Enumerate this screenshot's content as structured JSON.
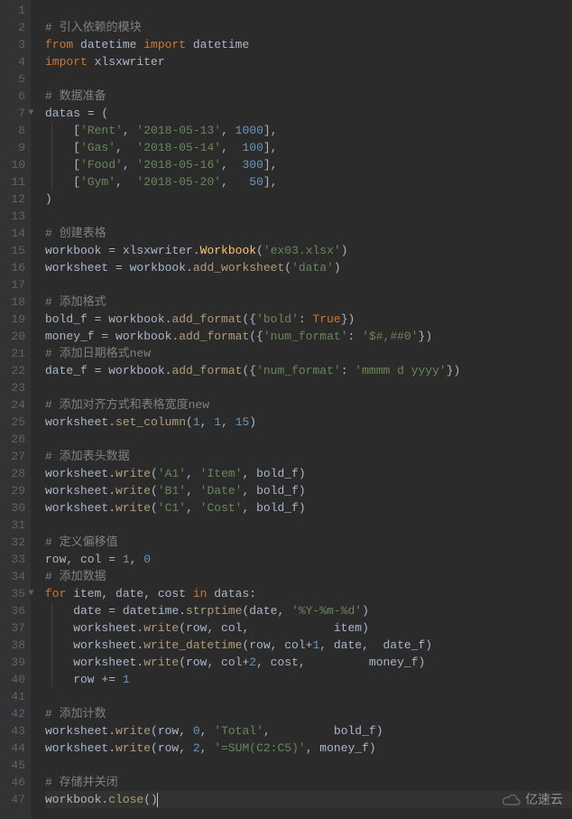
{
  "editor": {
    "line_count": 47,
    "current_line": 47,
    "fold_markers": [
      7,
      35
    ]
  },
  "code": {
    "l1": "",
    "l2": {
      "cm": "# 引入依赖的模块"
    },
    "l3": {
      "kw1": "from",
      "mod": " datetime ",
      "kw2": "import",
      "name": " datetime"
    },
    "l4": {
      "kw": "import",
      "name": " xlsxwriter"
    },
    "l5": "",
    "l6": {
      "cm": "# 数据准备"
    },
    "l7": {
      "lhs": "datas ",
      "op": "=",
      "rhs": " ("
    },
    "l8": {
      "open": "    [",
      "s1": "'Rent'",
      "c1": ", ",
      "s2": "'2018-05-13'",
      "c2": ", ",
      "n": "1000",
      "close": "],"
    },
    "l9": {
      "open": "    [",
      "s1": "'Gas'",
      "c1": ",  ",
      "s2": "'2018-05-14'",
      "c2": ",  ",
      "n": "100",
      "close": "],"
    },
    "l10": {
      "open": "    [",
      "s1": "'Food'",
      "c1": ", ",
      "s2": "'2018-05-16'",
      "c2": ",  ",
      "n": "300",
      "close": "],"
    },
    "l11": {
      "open": "    [",
      "s1": "'Gym'",
      "c1": ",  ",
      "s2": "'2018-05-20'",
      "c2": ",   ",
      "n": "50",
      "close": "],"
    },
    "l12": {
      "txt": ")"
    },
    "l13": "",
    "l14": {
      "cm": "# 创建表格"
    },
    "l15": {
      "a": "workbook ",
      "op": "=",
      "b": " xlsxwriter.",
      "fn": "Workbook",
      "c": "(",
      "s": "'ex03.xlsx'",
      "d": ")"
    },
    "l16": {
      "a": "worksheet ",
      "op": "=",
      "b": " workbook.",
      "fn": "add_worksheet",
      "c": "(",
      "s": "'data'",
      "d": ")"
    },
    "l17": "",
    "l18": {
      "cm": "# 添加格式"
    },
    "l19": {
      "a": "bold_f ",
      "op": "=",
      "b": " workbook.",
      "fn": "add_format",
      "c": "({",
      "s": "'bold'",
      "d": ": ",
      "kw": "True",
      "e": "})"
    },
    "l20": {
      "a": "money_f ",
      "op": "=",
      "b": " workbook.",
      "fn": "add_format",
      "c": "({",
      "s1": "'num_format'",
      "d": ": ",
      "s2": "'$#,##0'",
      "e": "})"
    },
    "l21": {
      "cm": "# 添加日期格式new"
    },
    "l22": {
      "a": "date_f ",
      "op": "=",
      "b": " workbook.",
      "fn": "add_format",
      "c": "({",
      "s1": "'num_format'",
      "d": ": ",
      "s2": "'mmmm d yyyy'",
      "e": "})"
    },
    "l23": "",
    "l24": {
      "cm": "# 添加对齐方式和表格宽度new"
    },
    "l25": {
      "a": "worksheet.",
      "fn": "set_column",
      "b": "(",
      "n1": "1",
      "c1": ", ",
      "n2": "1",
      "c2": ", ",
      "n3": "15",
      "d": ")"
    },
    "l26": "",
    "l27": {
      "cm": "# 添加表头数据"
    },
    "l28": {
      "a": "worksheet.",
      "fn": "write",
      "b": "(",
      "s1": "'A1'",
      "c": ", ",
      "s2": "'Item'",
      "d": ", bold_f)"
    },
    "l29": {
      "a": "worksheet.",
      "fn": "write",
      "b": "(",
      "s1": "'B1'",
      "c": ", ",
      "s2": "'Date'",
      "d": ", bold_f)"
    },
    "l30": {
      "a": "worksheet.",
      "fn": "write",
      "b": "(",
      "s1": "'C1'",
      "c": ", ",
      "s2": "'Cost'",
      "d": ", bold_f)"
    },
    "l31": "",
    "l32": {
      "cm": "# 定义偏移值"
    },
    "l33": {
      "a": "row, col ",
      "op": "=",
      "b": " ",
      "n1": "1",
      "c": ", ",
      "n2": "0"
    },
    "l34": {
      "cm": "# 添加数据"
    },
    "l35": {
      "kw1": "for",
      "a": " item, date, cost ",
      "kw2": "in",
      "b": " datas:"
    },
    "l36": {
      "a": "    date ",
      "op": "=",
      "b": " datetime.",
      "fn": "strptime",
      "c": "(date, ",
      "s": "'%Y-%m-%d'",
      "d": ")"
    },
    "l37": {
      "a": "    worksheet.",
      "fn": "write",
      "b": "(row, col,            item)"
    },
    "l38": {
      "a": "    worksheet.",
      "fn": "write_datetime",
      "b": "(row, col",
      "op": "+",
      "n": "1",
      "c": ", date,  date_f)"
    },
    "l39": {
      "a": "    worksheet.",
      "fn": "write",
      "b": "(row, col",
      "op": "+",
      "n": "2",
      "c": ", cost,         money_f)"
    },
    "l40": {
      "a": "    row ",
      "op": "+=",
      "b": " ",
      "n": "1"
    },
    "l41": "",
    "l42": {
      "cm": "# 添加计数"
    },
    "l43": {
      "a": "worksheet.",
      "fn": "write",
      "b": "(row, ",
      "n": "0",
      "c": ", ",
      "s": "'Total'",
      "d": ",         bold_f)"
    },
    "l44": {
      "a": "worksheet.",
      "fn": "write",
      "b": "(row, ",
      "n": "2",
      "c": ", ",
      "s": "'=SUM(C2:C5)'",
      "d": ", money_f)"
    },
    "l45": "",
    "l46": {
      "cm": "# 存储并关闭"
    },
    "l47": {
      "a": "workbook.",
      "fn": "close",
      "b": "()"
    }
  },
  "watermark": {
    "text": "亿速云"
  }
}
